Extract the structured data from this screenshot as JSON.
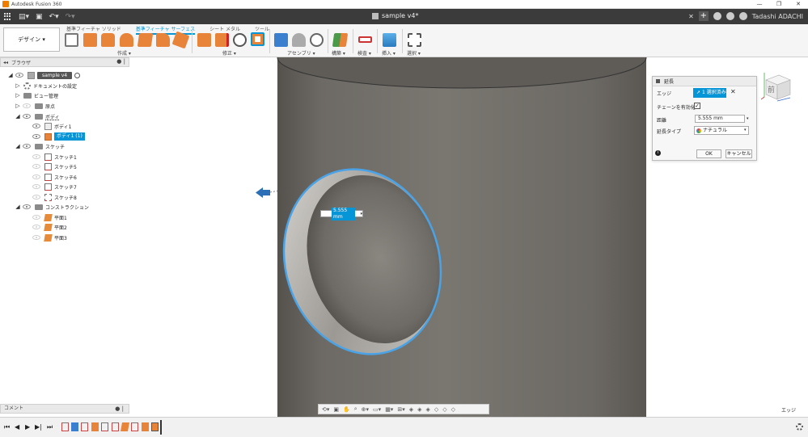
{
  "window": {
    "app_title": "Autodesk Fusion 360",
    "controls": [
      "—",
      "❐",
      "✕"
    ]
  },
  "doc_tabs": {
    "document_title": "sample v4*",
    "user_name": "Tadashi ADACHI"
  },
  "ribbon": {
    "workspace_button": "デザイン ▾",
    "tabs": [
      {
        "label": "基準フィーチャ ソリッド",
        "active": false
      },
      {
        "label": "基準フィーチャ サーフェス",
        "active": true
      },
      {
        "label": "シート メタル",
        "active": false
      },
      {
        "label": "ツール",
        "active": false
      }
    ],
    "groups": {
      "create": "作成 ▾",
      "modify": "修正 ▾",
      "assemble": "アセンブリ ▾",
      "construct": "構築 ▾",
      "inspect": "検査 ▾",
      "insert": "挿入 ▾",
      "select": "選択 ▾"
    }
  },
  "browser": {
    "title": "ブラウザ",
    "items": {
      "root": "sample v4",
      "doc_settings": "ドキュメントの設定",
      "views": "ビュー管理",
      "origin": "原点",
      "bodies": "ボディ",
      "body1": "ボディ1",
      "body1_copy": "ボディ1 (1)",
      "sketches": "スケッチ",
      "sketch1": "スケッチ1",
      "sketch5": "スケッチ5",
      "sketch6": "スケッチ6",
      "sketch7": "スケッチ7",
      "sketch8": "スケッチ8",
      "construction": "コンストラクション",
      "plane1": "平面1",
      "plane2": "平面2",
      "plane3": "平面3"
    }
  },
  "dialog": {
    "title": "延長",
    "edge_label": "エッジ",
    "edge_selection": "1 選択済み",
    "chain_label": "チェーンを有効化",
    "chain_checked": "✓",
    "distance_label": "距離",
    "distance_value": "5.555 mm",
    "extend_type_label": "延長タイプ",
    "extend_type_value": "ナチュラル",
    "ok": "OK",
    "cancel": "キャンセル"
  },
  "viewport": {
    "distance_input": "5.555 mm",
    "status_label": "エッジ"
  },
  "viewcube": {
    "face_label": "前"
  },
  "comment_panel": {
    "title": "コメント"
  },
  "colors": {
    "accent": "#0696d7",
    "dark_bar": "#3b3b3b",
    "model_surface": "#6e6b66"
  }
}
